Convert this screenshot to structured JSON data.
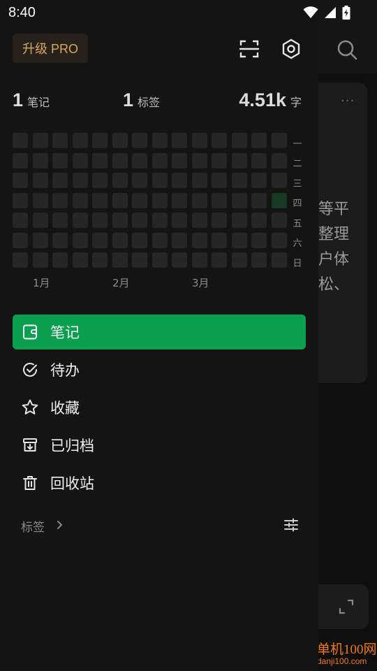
{
  "status_bar": {
    "time": "8:40"
  },
  "drawer": {
    "pro_button": "升级 PRO",
    "stats": [
      {
        "num": "1",
        "unit": "笔记"
      },
      {
        "num": "1",
        "unit": "标签"
      },
      {
        "num": "4.51k",
        "unit": "字"
      }
    ],
    "heatmap": {
      "weekdays": [
        "一",
        "二",
        "三",
        "四",
        "五",
        "六",
        "日"
      ],
      "months": [
        "1月",
        "2月",
        "3月"
      ],
      "active_cell": {
        "week": 13,
        "day": 3
      }
    },
    "nav": [
      {
        "label": "笔记",
        "icon": "note-icon",
        "active": true
      },
      {
        "label": "待办",
        "icon": "todo-check-icon",
        "active": false
      },
      {
        "label": "收藏",
        "icon": "star-icon",
        "active": false
      },
      {
        "label": "已归档",
        "icon": "archive-icon",
        "active": false
      },
      {
        "label": "回收站",
        "icon": "trash-icon",
        "active": false
      }
    ],
    "tags_label": "标签"
  },
  "background": {
    "card_text": [
      "等平",
      "整理",
      "户体",
      "松、"
    ],
    "card_more": "···"
  },
  "watermark": {
    "line1": "单机100网",
    "line2": "danji100.com"
  },
  "colors": {
    "accent": "#0aa04f",
    "pro_text": "#d9a85b",
    "drawer_bg": "#141414"
  }
}
